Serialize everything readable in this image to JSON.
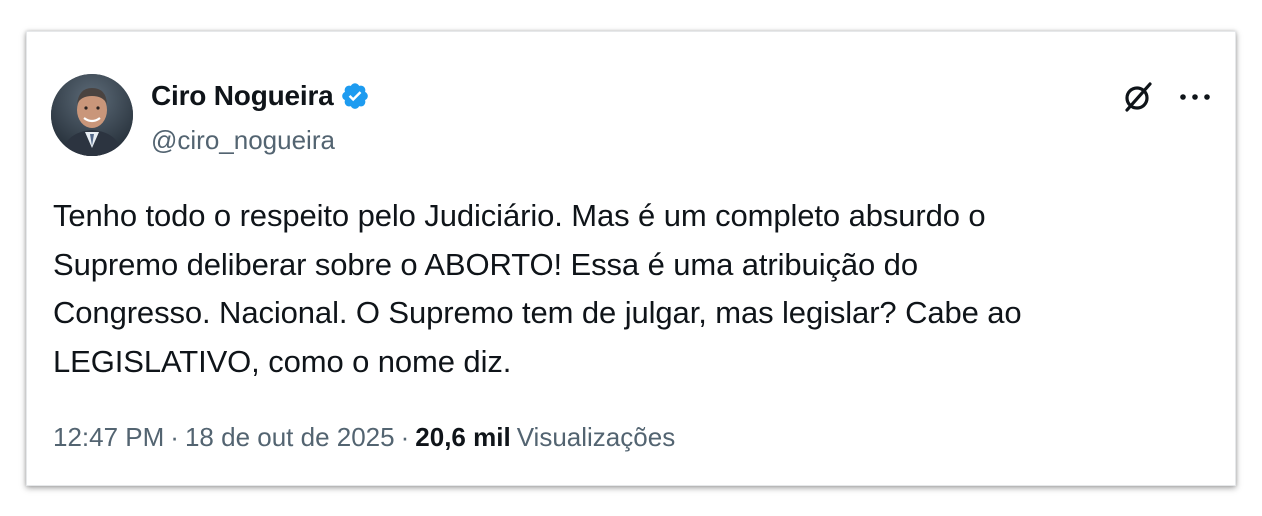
{
  "author": {
    "name": "Ciro Nogueira",
    "handle": "@ciro_nogueira",
    "verified": true,
    "verified_color": "#1d9bf0"
  },
  "icons": {
    "grok": "grok-icon",
    "more": "more-options-icon",
    "verified": "verified-badge-icon"
  },
  "tweet": {
    "lines": [
      "Tenho todo o respeito pelo Judiciário. Mas é um completo absurdo o",
      "Supremo deliberar sobre o ABORTO! Essa é uma atribuição do",
      "Congresso. Nacional. O Supremo tem de julgar, mas legislar? Cabe ao",
      "LEGISLATIVO, como o nome diz."
    ]
  },
  "meta": {
    "time": "12:47 PM",
    "separator": "·",
    "date": "18 de out de 2025",
    "views_count": "20,6 mil",
    "views_label": "Visualizações"
  }
}
